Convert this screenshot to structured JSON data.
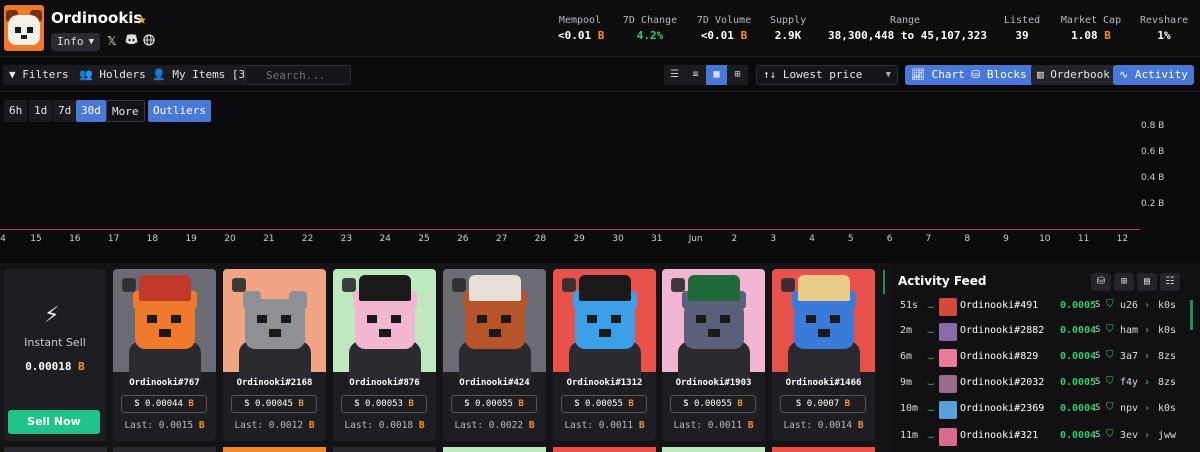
{
  "header": {
    "title": "Ordinookis",
    "info_label": "Info",
    "social_icons": [
      "x-icon",
      "discord-icon",
      "globe-icon"
    ],
    "stats": [
      {
        "label": "Mempool",
        "value": "<0.01",
        "unit": "B"
      },
      {
        "label": "7D Change",
        "value": "4.2%",
        "unit": ""
      },
      {
        "label": "7D Volume",
        "value": "<0.01",
        "unit": "B"
      },
      {
        "label": "Supply",
        "value": "2.9K",
        "unit": ""
      },
      {
        "label": "Range",
        "value": "38,300,448 to 45,107,323",
        "unit": ""
      },
      {
        "label": "Listed",
        "value": "39",
        "unit": ""
      },
      {
        "label": "Market Cap",
        "value": "1.08",
        "unit": "B"
      },
      {
        "label": "Revshare",
        "value": "1%",
        "unit": ""
      }
    ]
  },
  "toolbar": {
    "filters": "Filters",
    "holders": "Holders",
    "my_items": "My Items [3]",
    "search_placeholder": "Search...",
    "sort": "Lowest price",
    "chart": "Chart",
    "blocks": "Blocks",
    "orderbook": "Orderbook",
    "activity": "Activity"
  },
  "chart": {
    "ranges": [
      "6h",
      "1d",
      "7d",
      "30d",
      "More",
      "Outliers"
    ],
    "active_range": "30d",
    "y_ticks": [
      "0.8 B",
      "0.6 B",
      "0.4 B",
      "0.2 B"
    ],
    "x_ticks": [
      "4",
      "15",
      "16",
      "17",
      "18",
      "19",
      "20",
      "21",
      "22",
      "23",
      "24",
      "25",
      "26",
      "27",
      "28",
      "29",
      "30",
      "31",
      "Jun",
      "2",
      "3",
      "4",
      "5",
      "6",
      "7",
      "8",
      "9",
      "10",
      "11",
      "12"
    ],
    "line_color": "#c83a4a"
  },
  "instant_sell": {
    "label": "Instant Sell",
    "value": "0.00018",
    "unit": "B",
    "button": "Sell Now"
  },
  "cards": [
    {
      "name": "Ordinooki#767",
      "price": "0.00044",
      "last": "Last: 0.0015",
      "bg": "#6b6b73",
      "fur": "#f07a2b",
      "hat": "#c0392b"
    },
    {
      "name": "Ordinooki#2168",
      "price": "0.00045",
      "last": "Last: 0.0012",
      "bg": "#f2a584",
      "fur": "#8f8f96",
      "hat": ""
    },
    {
      "name": "Ordinooki#876",
      "price": "0.00053",
      "last": "Last: 0.0018",
      "bg": "#bfe8c0",
      "fur": "#f3b6d0",
      "hat": "#1a1a1a"
    },
    {
      "name": "Ordinooki#424",
      "price": "0.00055",
      "last": "Last: 0.0022",
      "bg": "#6b6b73",
      "fur": "#b6542a",
      "hat": "#e8e0d8"
    },
    {
      "name": "Ordinooki#1312",
      "price": "0.00055",
      "last": "Last: 0.0011",
      "bg": "#e8524a",
      "fur": "#3aa0e8",
      "hat": "#1a1a1a"
    },
    {
      "name": "Ordinooki#1903",
      "price": "0.00055",
      "last": "Last: 0.0011",
      "bg": "#f2b6d2",
      "fur": "#5a5f7a",
      "hat": "#1f6a3a"
    },
    {
      "name": "Ordinooki#1466",
      "price": "0.0007",
      "last": "Last: 0.0014",
      "bg": "#e8524a",
      "fur": "#3a7ad8",
      "hat": "#e8cc88"
    }
  ],
  "activity_feed": {
    "title": "Activity Feed",
    "rows": [
      {
        "time": "51s",
        "name": "Ordinooki#491",
        "price": "0.0005",
        "from": "u26",
        "to": "k0s",
        "av": "#d24a3a"
      },
      {
        "time": "2m",
        "name": "Ordinooki#2882",
        "price": "0.0004",
        "from": "ham",
        "to": "k0s",
        "av": "#8a6aa8"
      },
      {
        "time": "6m",
        "name": "Ordinooki#829",
        "price": "0.0004",
        "from": "3a7",
        "to": "8zs",
        "av": "#e87a9a"
      },
      {
        "time": "9m",
        "name": "Ordinooki#2032",
        "price": "0.0005",
        "from": "f4y",
        "to": "8zs",
        "av": "#9a6a8a"
      },
      {
        "time": "10m",
        "name": "Ordinooki#2369",
        "price": "0.0004",
        "from": "npv",
        "to": "k0s",
        "av": "#5aa0d8"
      },
      {
        "time": "11m",
        "name": "Ordinooki#321",
        "price": "0.0004",
        "from": "3ev",
        "to": "jww",
        "av": "#d86a8a"
      }
    ]
  }
}
